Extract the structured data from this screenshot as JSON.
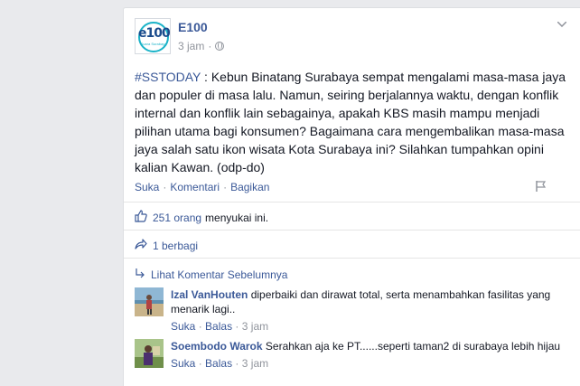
{
  "post": {
    "page_name": "E100",
    "time": "3 jam",
    "hashtag": "#SSTODAY",
    "body": " : Kebun Binatang Surabaya sempat mengalami masa-masa jaya dan populer di masa lalu. Namun, seiring berjalannya waktu, dengan konflik internal dan konflik lain sebagainya, apakah KBS masih mampu menjadi pilihan utama bagi konsumen? Bagaimana cara mengembalikan masa-masa jaya salah satu ikon wisata Kota Surabaya ini? Silahkan tumpahkan opini kalian Kawan. (odp-do)",
    "logo_text": "e100",
    "logo_sub": "Suara Surabaya"
  },
  "actions": {
    "like": "Suka",
    "comment": "Komentari",
    "share": "Bagikan"
  },
  "likes": {
    "count_text": "251 orang",
    "suffix": "menyukai ini."
  },
  "shares": {
    "text": "1 berbagi"
  },
  "view_previous": "Lihat Komentar Sebelumnya",
  "comments": [
    {
      "name": "Izal VanHouten",
      "text": "diperbaiki dan dirawat total, serta menambahkan fasilitas yang menarik lagi..",
      "like": "Suka",
      "reply": "Balas",
      "time": "3 jam"
    },
    {
      "name": "Soembodo Warok",
      "text": "Serahkan aja ke PT......seperti taman2 di surabaya lebih hijau",
      "like": "Suka",
      "reply": "Balas",
      "time": "3 jam"
    }
  ],
  "colors": {
    "link": "#3b5998",
    "meta": "#90949c",
    "background": "#e9eaed",
    "logo_teal": "#1ab3c8"
  }
}
